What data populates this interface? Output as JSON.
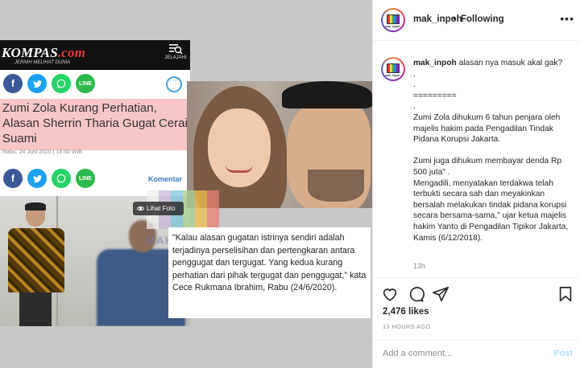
{
  "colors": {
    "link_blue": "#3d7bc6",
    "post_button_disabled": "#b2dffc",
    "headline_bg": "#f7c6c6",
    "text_dark": "#262626",
    "text_muted": "#8e8e8e"
  },
  "article": {
    "site_logo": "KOMPAS",
    "site_logo_suffix": ".com",
    "site_tagline": "JERNIH MELIHAT DUNIA",
    "menu_label": "JELAJAHI",
    "headline": "Zumi Zola Kurang Perhatian, Alasan Sherrin Tharia Gugat Cerai Suami",
    "dateline": "Rabu, 24 Juni 2020 | 16:50 WIB",
    "komentar_label": "Komentar",
    "share_icons": [
      "facebook-icon",
      "twitter-icon",
      "whatsapp-icon",
      "line-icon"
    ],
    "line_label": "LINE",
    "lihat_foto_label": "Lihat Foto",
    "watermark_text": "MAKINPOH",
    "watermark_colors": [
      "#f0f0f0",
      "#c8b9d6",
      "#7ec4dc",
      "#a9d18e",
      "#f2c14e",
      "#e8826f"
    ],
    "quote": "\"Kalau alasan gugatan istrinya sendiri adalah terjadinya perselisihan dan pertengkaran antara penggugat dan tergugat. Yang kedua kurang perhatian dari pihak tergugat dan penggugat,\" kata Cece Rukmana Ibrahim, Rabu (24/6/2020)."
  },
  "header": {
    "username": "mak_inpoh",
    "separator": "•",
    "follow_status": "Following",
    "more_icon": "more-dots-icon"
  },
  "avatar": {
    "tv_colors": [
      "#e53935",
      "#fdd835",
      "#43a047",
      "#1e88e5",
      "#8e24aa"
    ],
    "caption": "mak_inpoh"
  },
  "caption": {
    "username": "mak_inpoh",
    "text": "alasan nya masuk akal gak?\n.\n.\n=========\n.\nZumi Zola dihukum 6 tahun penjara oleh majelis hakim pada Pengadilan Tindak Pidana Korupsi Jakarta.\n\nZumi juga dihukum membayar denda Rp 500 juta\" .\nMengadili, menyatakan terdakwa telah terbukti secara sah dan meyakinkan bersalah melakukan tindak pidana korupsi secara bersama-sama,\" ujar ketua majelis hakim Yanto di Pengadilan Tipikor Jakarta, Kamis (6/12/2018).",
    "time": "13h"
  },
  "actions": {
    "icons": [
      "heart-icon",
      "comment-icon",
      "share-icon",
      "bookmark-icon"
    ],
    "likes": "2,476 likes",
    "posted_ago": "13 HOURS AGO"
  },
  "comment": {
    "placeholder": "Add a comment...",
    "post_label": "Post"
  }
}
